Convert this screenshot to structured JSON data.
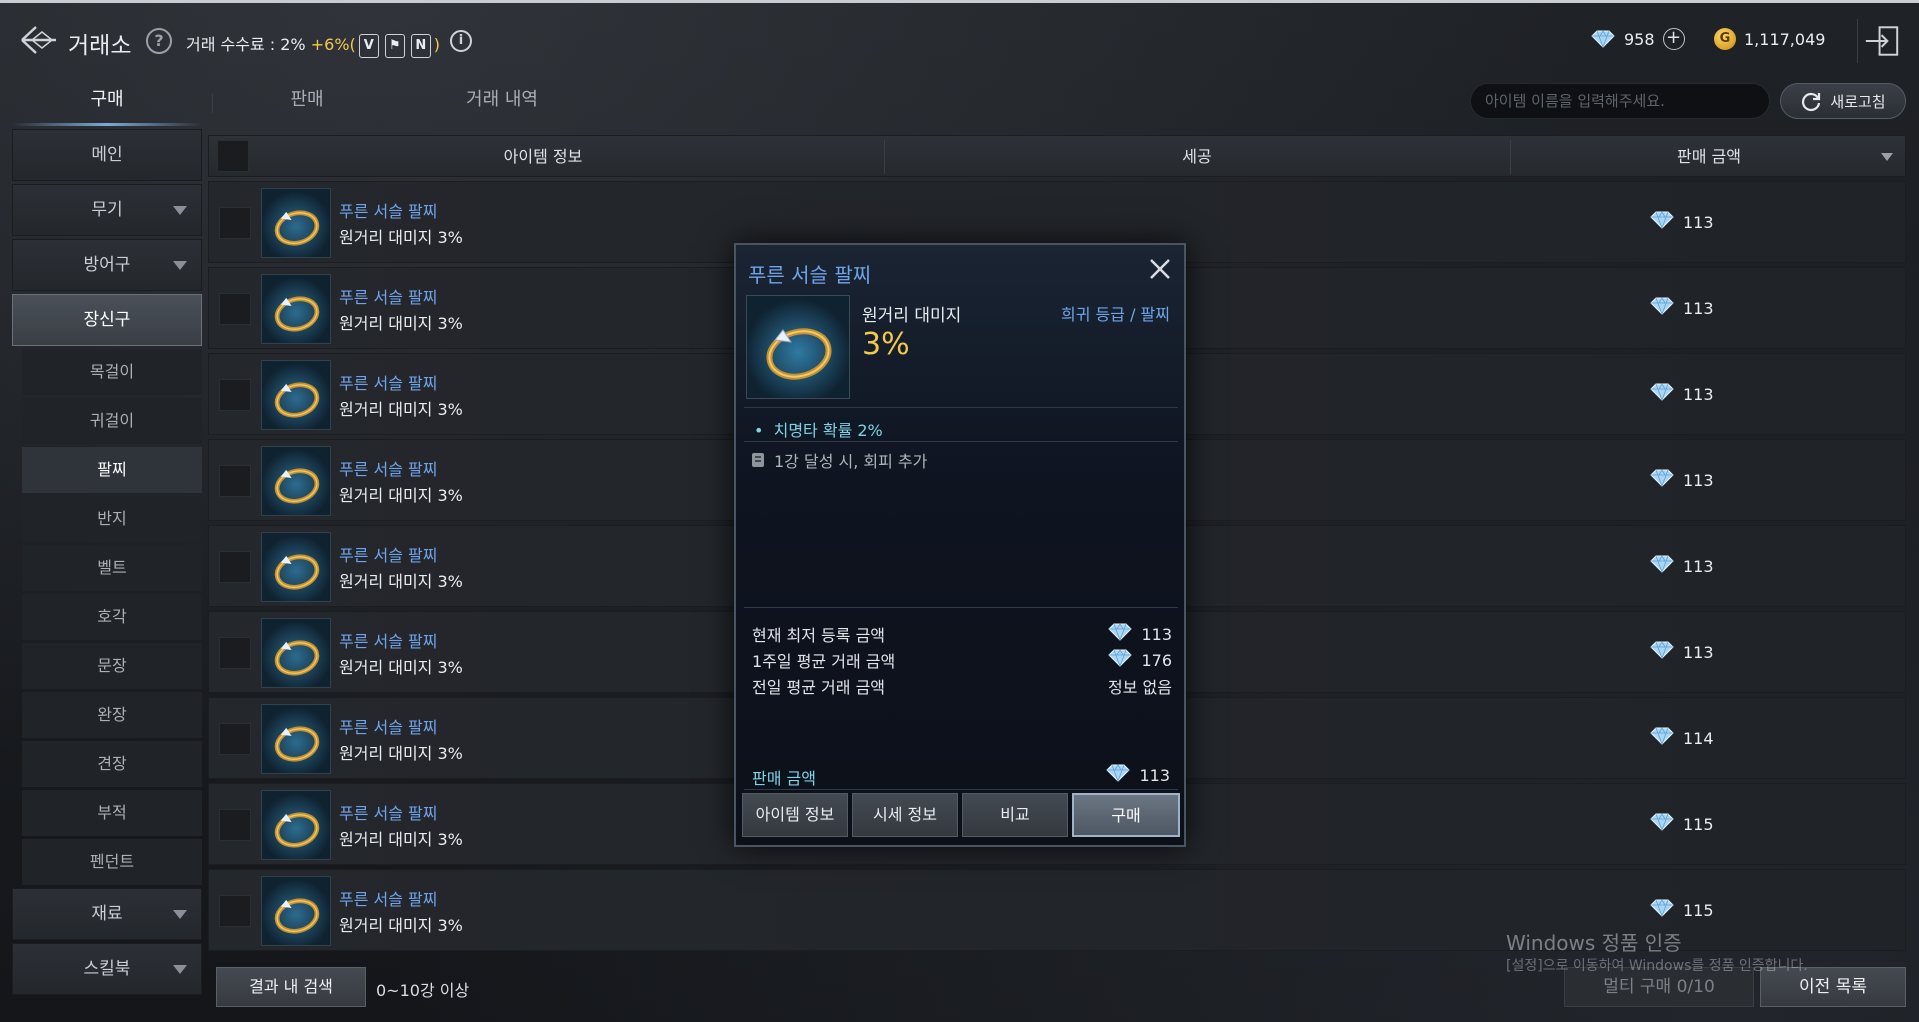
{
  "header": {
    "title": "거래소",
    "fee_label": "거래 수수료 : 2%",
    "fee_extra": "+6%(",
    "fee_close": ")",
    "badges": [
      "V",
      "⚑",
      "N"
    ],
    "crystals": "958",
    "gold": "1,117,049",
    "gold_symbol": "G"
  },
  "tabs": [
    {
      "label": "구매",
      "active": true
    },
    {
      "label": "판매",
      "active": false
    },
    {
      "label": "거래 내역",
      "active": false
    }
  ],
  "search": {
    "placeholder": "아이템 이름을 입력해주세요."
  },
  "refresh_label": "새로고침",
  "sidebar": {
    "top": [
      {
        "label": "메인",
        "has_arrow": false
      },
      {
        "label": "무기",
        "has_arrow": true
      },
      {
        "label": "방어구",
        "has_arrow": true
      },
      {
        "label": "장신구",
        "has_arrow": false,
        "active": true
      }
    ],
    "sub": [
      {
        "label": "목걸이"
      },
      {
        "label": "귀걸이"
      },
      {
        "label": "팔찌",
        "active": true
      },
      {
        "label": "반지"
      },
      {
        "label": "벨트"
      },
      {
        "label": "호각"
      },
      {
        "label": "문장"
      },
      {
        "label": "완장"
      },
      {
        "label": "견장"
      },
      {
        "label": "부적"
      },
      {
        "label": "펜던트"
      }
    ],
    "bottom": [
      {
        "label": "재료",
        "has_arrow": true
      },
      {
        "label": "스킬북",
        "has_arrow": true
      }
    ]
  },
  "table": {
    "headers": {
      "info": "아이템 정보",
      "refine": "세공",
      "price": "판매 금액"
    },
    "rows": [
      {
        "name": "푸른 서슬 팔찌",
        "stat": "원거리 대미지 3%",
        "price": "113"
      },
      {
        "name": "푸른 서슬 팔찌",
        "stat": "원거리 대미지 3%",
        "price": "113"
      },
      {
        "name": "푸른 서슬 팔찌",
        "stat": "원거리 대미지 3%",
        "price": "113"
      },
      {
        "name": "푸른 서슬 팔찌",
        "stat": "원거리 대미지 3%",
        "price": "113"
      },
      {
        "name": "푸른 서슬 팔찌",
        "stat": "원거리 대미지 3%",
        "price": "113"
      },
      {
        "name": "푸른 서슬 팔찌",
        "stat": "원거리 대미지 3%",
        "price": "113"
      },
      {
        "name": "푸른 서슬 팔찌",
        "stat": "원거리 대미지 3%",
        "price": "114"
      },
      {
        "name": "푸른 서슬 팔찌",
        "stat": "원거리 대미지 3%",
        "price": "115"
      },
      {
        "name": "푸른 서슬 팔찌",
        "stat": "원거리 대미지 3%",
        "price": "115"
      }
    ]
  },
  "footer": {
    "search_result": "결과 내 검색",
    "range": "0~10강 이상",
    "multi_buy": "멀티 구매 0/10",
    "prev_list": "이전 목록"
  },
  "watermark": {
    "line1": "Windows 정품 인증",
    "line2": "[설정]으로 이동하여 Windows를 정품 인증합니다."
  },
  "popup": {
    "title": "푸른 서슬 팔찌",
    "stat_name": "원거리 대미지",
    "stat_value": "3%",
    "grade": "희귀 등급 / 팔찌",
    "bonus_bullet": "•",
    "bonus": "치명타 확률  2%",
    "hone_note": "1강 달성 시, 회피 추가",
    "prices": [
      {
        "label": "현재 최저 등록 금액",
        "value": "113",
        "crystal": true
      },
      {
        "label": "1주일 평균 거래 금액",
        "value": "176",
        "crystal": true
      },
      {
        "label": "전일 평균 거래 금액",
        "value": "정보 없음",
        "crystal": false
      }
    ],
    "sale_label": "판매 금액",
    "sale_value": "113",
    "buttons": [
      "아이템 정보",
      "시세 정보",
      "비교",
      "구매"
    ]
  },
  "colors": {
    "item_name": "#6fa4ea",
    "stat_value": "#f2c94c",
    "bonus": "#7fd3e6",
    "fee_extra": "#f2c94c"
  }
}
